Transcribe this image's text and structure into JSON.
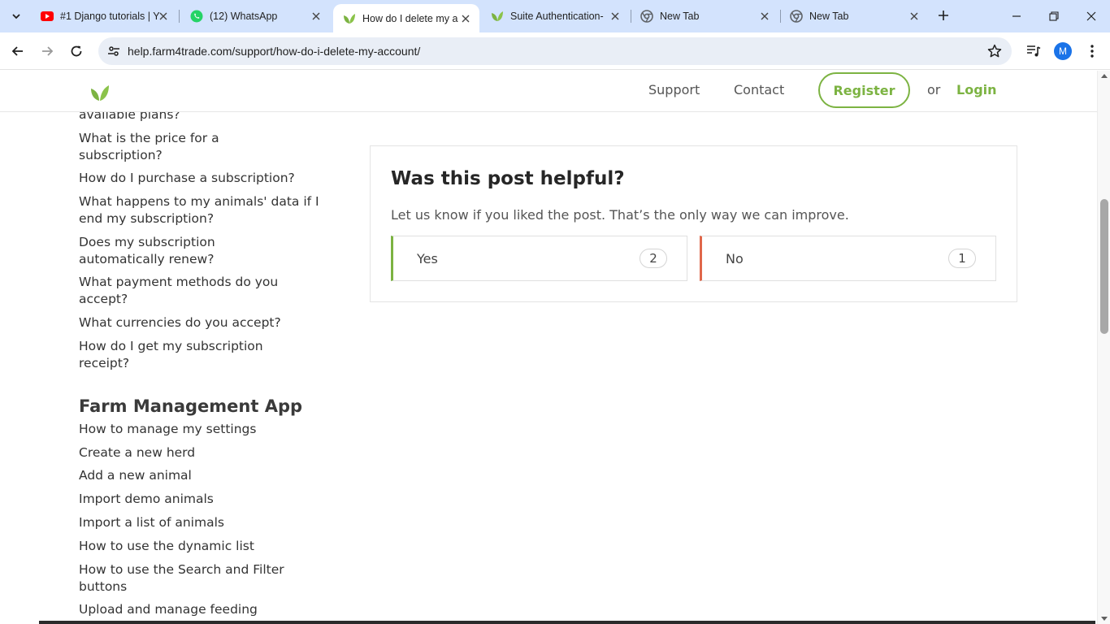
{
  "browser": {
    "tabs": [
      {
        "title": "#1 Django tutorials | Y",
        "icon": "youtube-icon",
        "active": false
      },
      {
        "title": "(12) WhatsApp",
        "icon": "whatsapp-icon",
        "active": false
      },
      {
        "title": "How do I delete my a",
        "icon": "farm4trade-leaf-icon",
        "active": true
      },
      {
        "title": "Suite Authentication-",
        "icon": "farm4trade-leaf-icon",
        "active": false
      },
      {
        "title": "New Tab",
        "icon": "chrome-icon",
        "active": false
      },
      {
        "title": "New Tab",
        "icon": "chrome-icon",
        "active": false
      }
    ],
    "url": "help.farm4trade.com/support/how-do-i-delete-my-account/",
    "profile_initial": "M"
  },
  "header": {
    "nav": [
      {
        "label": "Support"
      },
      {
        "label": "Contact"
      }
    ],
    "register_label": "Register",
    "or_label": "or",
    "login_label": "Login"
  },
  "sidebar": {
    "subscription_links": [
      {
        "label": "available plans?"
      },
      {
        "label": "What is the price for a subscription?"
      },
      {
        "label": "How do I purchase a subscription?"
      },
      {
        "label": "What happens to my animals' data if I end my subscription?"
      },
      {
        "label": "Does my subscription automatically renew?"
      },
      {
        "label": "What payment methods do you accept?"
      },
      {
        "label": "What currencies do you accept?"
      },
      {
        "label": "How do I get my subscription receipt?"
      }
    ],
    "section_title": "Farm Management App",
    "app_links": [
      {
        "label": "How to manage my settings"
      },
      {
        "label": "Create a new herd"
      },
      {
        "label": "Add a new animal"
      },
      {
        "label": "Import demo animals"
      },
      {
        "label": "Import a list of animals"
      },
      {
        "label": "How to use the dynamic list"
      },
      {
        "label": "How to use the Search and Filter buttons"
      },
      {
        "label": "Upload and manage feeding"
      }
    ]
  },
  "feedback": {
    "title": "Was this post helpful?",
    "subtitle": "Let us know if you liked the post. That’s the only way we can improve.",
    "yes_label": "Yes",
    "yes_count": "2",
    "no_label": "No",
    "no_count": "1"
  },
  "colors": {
    "brand_green": "#7cb342",
    "no_accent": "#e0674a",
    "tabbar": "#d3e3fd"
  }
}
